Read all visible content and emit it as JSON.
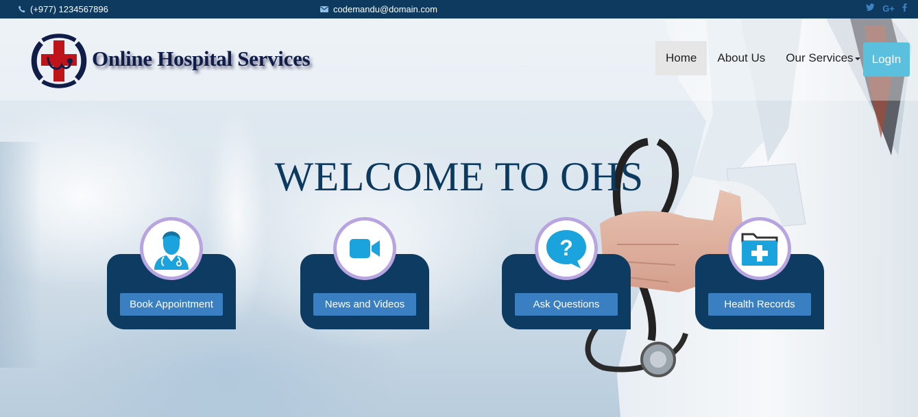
{
  "topbar": {
    "phone": "(+977) 1234567896",
    "email": "codemandu@domain.com",
    "social": [
      "twitter-icon",
      "google-plus-icon",
      "facebook-icon"
    ],
    "google_label": "G+"
  },
  "header": {
    "logo_text": "Online Hospital Services",
    "nav": [
      {
        "label": "Home",
        "active": true
      },
      {
        "label": "About Us",
        "active": false
      },
      {
        "label": "Our Services",
        "active": false,
        "dropdown": true
      }
    ],
    "login_label": "LogIn"
  },
  "hero": {
    "title": "WELCOME TO OHS"
  },
  "services": [
    {
      "label": "Book Appointment",
      "icon": "doctor-icon"
    },
    {
      "label": "News and Videos",
      "icon": "video-camera-icon"
    },
    {
      "label": "Ask Questions",
      "icon": "question-bubble-icon"
    },
    {
      "label": "Health Records",
      "icon": "medical-folder-icon"
    }
  ],
  "colors": {
    "topbar": "#0d3a5e",
    "card_panel": "#0e3b61",
    "card_button": "#3a7fc1",
    "login_button": "#5bc0de",
    "icon_blue": "#1aa3dc",
    "icon_ring": "#b7a4e0",
    "welcome_text": "#0b3a5e"
  }
}
